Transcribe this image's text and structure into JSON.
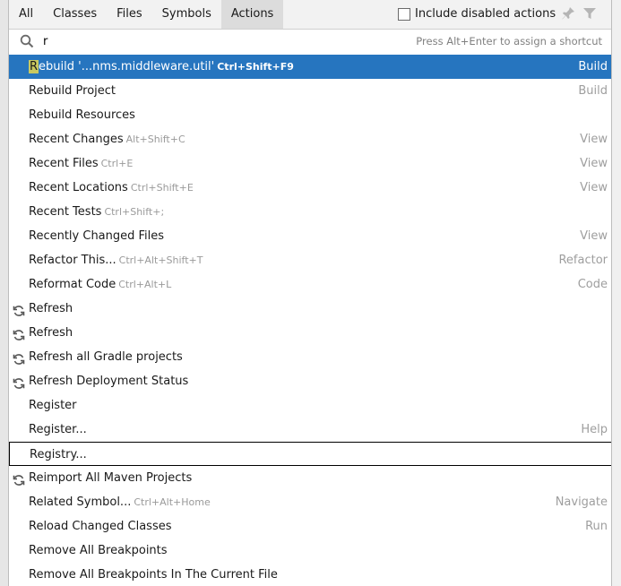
{
  "tabs": [
    {
      "label": "All",
      "active": false
    },
    {
      "label": "Classes",
      "active": false
    },
    {
      "label": "Files",
      "active": false
    },
    {
      "label": "Symbols",
      "active": false
    },
    {
      "label": "Actions",
      "active": true
    }
  ],
  "options": {
    "include_disabled_label": "Include disabled actions",
    "include_disabled_checked": false
  },
  "search": {
    "value": "r",
    "hint": "Press Alt+Enter to assign a shortcut"
  },
  "items": [
    {
      "label_hl": "R",
      "label": "ebuild '...nms.middleware.util'",
      "shortcut": "Ctrl+Shift+F9",
      "group": "Build",
      "icon": "",
      "selected": true
    },
    {
      "label": "Rebuild Project",
      "shortcut": "",
      "group": "Build",
      "icon": ""
    },
    {
      "label": "Rebuild Resources",
      "shortcut": "",
      "group": "",
      "icon": ""
    },
    {
      "label": "Recent Changes",
      "shortcut": "Alt+Shift+C",
      "group": "View",
      "icon": ""
    },
    {
      "label": "Recent Files",
      "shortcut": "Ctrl+E",
      "group": "View",
      "icon": ""
    },
    {
      "label": "Recent Locations",
      "shortcut": "Ctrl+Shift+E",
      "group": "View",
      "icon": ""
    },
    {
      "label": "Recent Tests",
      "shortcut": "Ctrl+Shift+;",
      "group": "",
      "icon": ""
    },
    {
      "label": "Recently Changed Files",
      "shortcut": "",
      "group": "View",
      "icon": ""
    },
    {
      "label": "Refactor This...",
      "shortcut": "Ctrl+Alt+Shift+T",
      "group": "Refactor",
      "icon": ""
    },
    {
      "label": "Reformat Code",
      "shortcut": "Ctrl+Alt+L",
      "group": "Code",
      "icon": ""
    },
    {
      "label": "Refresh",
      "shortcut": "",
      "group": "",
      "icon": "refresh-icon"
    },
    {
      "label": "Refresh",
      "shortcut": "",
      "group": "",
      "icon": "refresh-icon"
    },
    {
      "label": "Refresh all Gradle projects",
      "shortcut": "",
      "group": "",
      "icon": "refresh-icon"
    },
    {
      "label": "Refresh Deployment Status",
      "shortcut": "",
      "group": "",
      "icon": "refresh-icon"
    },
    {
      "label": "Register",
      "shortcut": "",
      "group": "",
      "icon": ""
    },
    {
      "label": "Register...",
      "shortcut": "",
      "group": "Help",
      "icon": ""
    },
    {
      "label": "Registry...",
      "shortcut": "",
      "group": "",
      "icon": "",
      "outlined": true
    },
    {
      "label": "Reimport All Maven Projects",
      "shortcut": "",
      "group": "",
      "icon": "refresh-icon"
    },
    {
      "label": "Related Symbol...",
      "shortcut": "Ctrl+Alt+Home",
      "group": "Navigate",
      "icon": ""
    },
    {
      "label": "Reload Changed Classes",
      "shortcut": "",
      "group": "Run",
      "icon": ""
    },
    {
      "label": "Remove All Breakpoints",
      "shortcut": "",
      "group": "",
      "icon": ""
    },
    {
      "label": "Remove All Breakpoints In The Current File",
      "shortcut": "",
      "group": "",
      "icon": ""
    }
  ],
  "colors": {
    "selection": "#2675bf",
    "highlight": "#c8c860",
    "group_text": "#9e9e9e"
  }
}
